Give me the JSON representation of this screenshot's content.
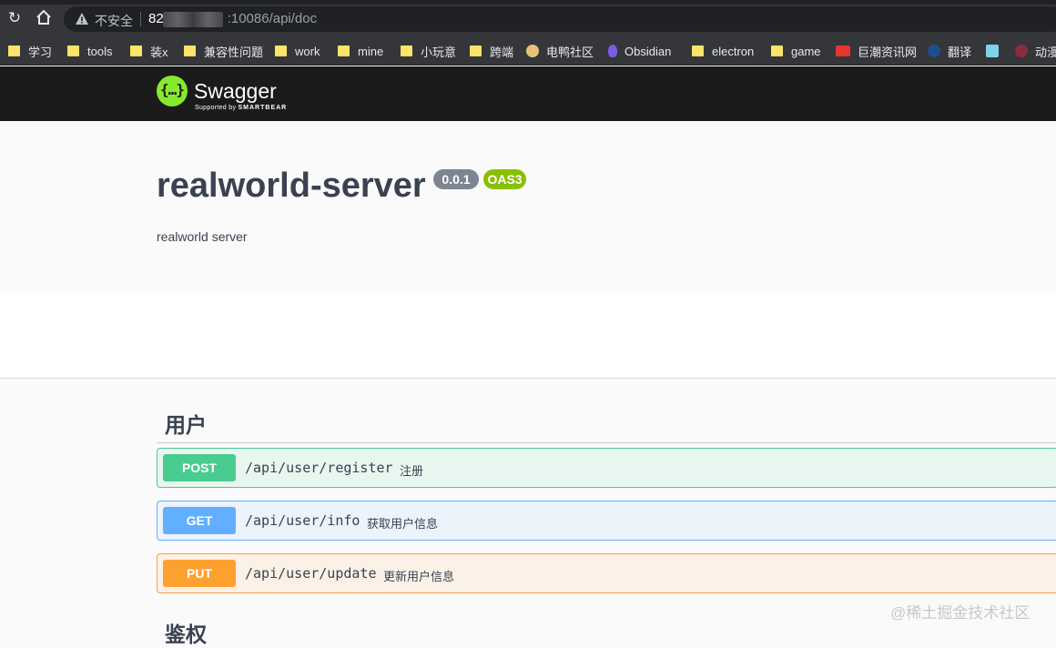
{
  "browser": {
    "insecure_label": "不安全",
    "url_host_prefix": "82",
    "url_rest": ":10086/api/doc",
    "bookmarks": [
      {
        "label": "学习",
        "type": "folder"
      },
      {
        "label": "tools",
        "type": "folder"
      },
      {
        "label": "装x",
        "type": "folder"
      },
      {
        "label": "兼容性问题",
        "type": "folder"
      },
      {
        "label": "work",
        "type": "folder"
      },
      {
        "label": "mine",
        "type": "folder"
      },
      {
        "label": "小玩意",
        "type": "folder"
      },
      {
        "label": "跨端",
        "type": "folder"
      },
      {
        "label": "电鸭社区",
        "type": "site",
        "icon": "duck-icon"
      },
      {
        "label": "Obsidian",
        "type": "site",
        "icon": "obsidian-icon"
      },
      {
        "label": "electron",
        "type": "folder"
      },
      {
        "label": "game",
        "type": "folder"
      },
      {
        "label": "巨潮资讯网",
        "type": "site",
        "icon": "cninfo-icon"
      },
      {
        "label": "翻译",
        "type": "site",
        "icon": "translate-icon"
      },
      {
        "label": "",
        "type": "site",
        "icon": "doc-icon"
      },
      {
        "label": "动漫",
        "type": "site",
        "icon": "anime-icon"
      }
    ]
  },
  "swagger": {
    "logo_text": "Swagger",
    "logo_glyph": "{…}",
    "supported_by": "Supported by",
    "smartbear": "SMARTBEAR"
  },
  "info": {
    "title": "realworld-server",
    "version": "0.0.1",
    "oas": "OAS3",
    "description": "realworld server"
  },
  "tags": [
    {
      "name": "用户",
      "operations": [
        {
          "method": "POST",
          "path": "/api/user/register",
          "summary": "注册"
        },
        {
          "method": "GET",
          "path": "/api/user/info",
          "summary": "获取用户信息"
        },
        {
          "method": "PUT",
          "path": "/api/user/update",
          "summary": "更新用户信息"
        }
      ]
    },
    {
      "name": "鉴权"
    }
  ],
  "watermark": "@稀土掘金技术社区",
  "colors": {
    "post": "#49cc90",
    "get": "#61affe",
    "put": "#fca130",
    "oas_badge": "#89bf04",
    "version_badge": "#7d8492",
    "swagger_green": "#85ea2d"
  }
}
